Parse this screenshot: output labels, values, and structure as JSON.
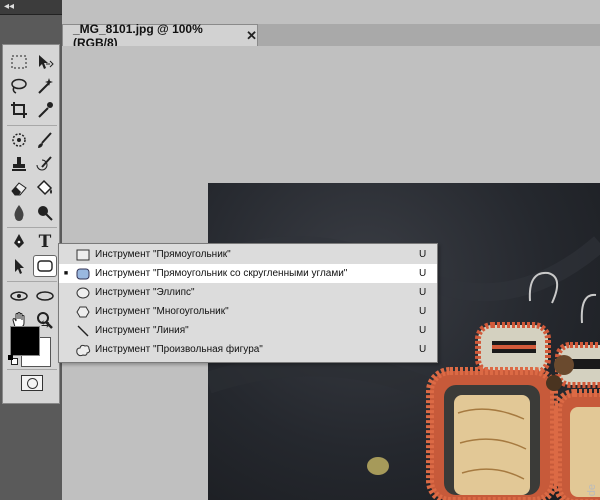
{
  "panel": {
    "collapse_glyph": "◂◂"
  },
  "document_tab": {
    "title": "_MG_8101.jpg @ 100% (RGB/8)",
    "close_glyph": "✕"
  },
  "flyout": {
    "items": [
      {
        "label": "Инструмент \"Прямоугольник\"",
        "shortcut": "U",
        "selected": false,
        "icon": "rectangle-icon"
      },
      {
        "label": "Инструмент \"Прямоугольник со скругленными углами\"",
        "shortcut": "U",
        "selected": true,
        "icon": "rounded-rectangle-icon"
      },
      {
        "label": "Инструмент \"Эллипс\"",
        "shortcut": "U",
        "selected": false,
        "icon": "ellipse-icon"
      },
      {
        "label": "Инструмент \"Многоугольник\"",
        "shortcut": "U",
        "selected": false,
        "icon": "polygon-icon"
      },
      {
        "label": "Инструмент \"Линия\"",
        "shortcut": "U",
        "selected": false,
        "icon": "line-icon"
      },
      {
        "label": "Инструмент \"Произвольная фигура\"",
        "shortcut": "U",
        "selected": false,
        "icon": "custom-shape-icon"
      }
    ],
    "selected_marker": "■"
  },
  "tools": {
    "type_tool_glyph": "T"
  },
  "colors": {
    "foreground": "#000000",
    "background": "#ffffff",
    "selected_row": "#ffffff",
    "flyout_bg": "#dcdcdc"
  },
  "watermark": "de"
}
